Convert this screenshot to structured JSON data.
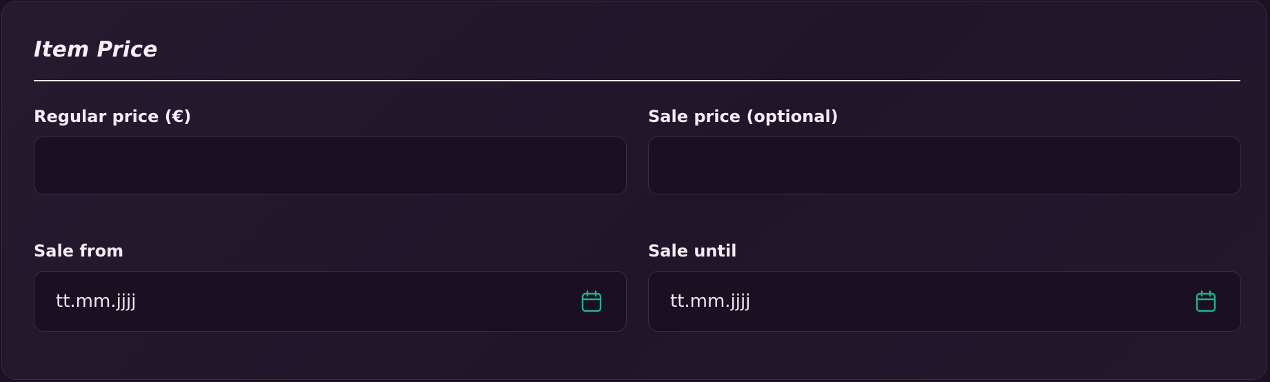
{
  "section": {
    "title": "Item Price"
  },
  "fields": {
    "regular_price": {
      "label": "Regular price (€)",
      "value": ""
    },
    "sale_price": {
      "label": "Sale price (optional)",
      "value": ""
    },
    "sale_from": {
      "label": "Sale from",
      "display": "tt.mm.jjjj",
      "icon": "calendar-icon"
    },
    "sale_until": {
      "label": "Sale until",
      "display": "tt.mm.jjjj",
      "icon": "calendar-icon"
    }
  },
  "colors": {
    "background": "#21152a",
    "text": "#f1edf4",
    "accent": "#22b38c",
    "border": "#3c2c44"
  }
}
